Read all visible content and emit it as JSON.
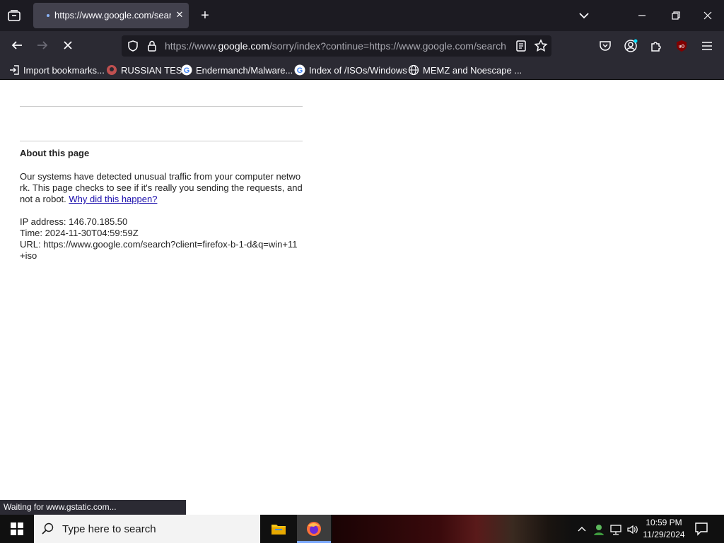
{
  "browser": {
    "tab": {
      "title": "https://www.google.com/search"
    },
    "url": {
      "scheme": "https://www.",
      "host": "google.com",
      "rest": "/sorry/index?continue=https://www.google.com/search"
    },
    "bookmarks": [
      {
        "label": "Import bookmarks...",
        "icon": "import-icon"
      },
      {
        "label": "RUSSIAN TEST",
        "icon": "github-icon"
      },
      {
        "label": "Endermanch/Malware...",
        "icon": "google-icon"
      },
      {
        "label": "Index of /ISOs/Windows",
        "icon": "google-icon"
      },
      {
        "label": "MEMZ and Noescape ...",
        "icon": "globe-icon"
      }
    ],
    "status": "Waiting for www.gstatic.com..."
  },
  "page": {
    "about_title": "About this page",
    "body_text": "Our systems have detected unusual traffic from your computer network. This page checks to see if it's really you sending the requests, and not a robot.",
    "why_link": "Why did this happen?",
    "ip_line": "IP address: 146.70.185.50",
    "time_line": "Time: 2024-11-30T04:59:59Z",
    "url_line": "URL: https://www.google.com/search?client=firefox-b-1-d&q=win+11+iso"
  },
  "taskbar": {
    "search_placeholder": "Type here to search",
    "time": "10:59 PM",
    "date": "11/29/2024"
  },
  "colors": {
    "firefox_dark": "#1c1b22",
    "toolbar": "#2b2a33",
    "link": "#1a0dab",
    "ublock_red": "#800000"
  }
}
